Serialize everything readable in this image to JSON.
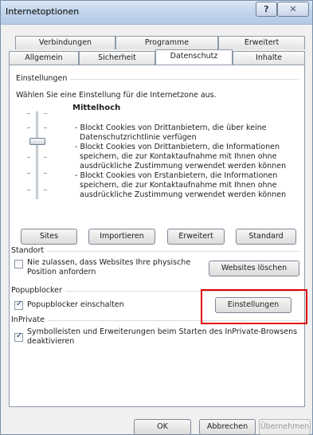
{
  "window": {
    "title": "Internetoptionen",
    "help_label": "?",
    "close_label": "✕"
  },
  "tabs_back": [
    "Verbindungen",
    "Programme",
    "Erweitert"
  ],
  "tabs_front": [
    "Allgemein",
    "Sicherheit",
    "Datenschutz",
    "Inhalte"
  ],
  "settings": {
    "group_label": "Einstellungen",
    "instruction": "Wählen Sie eine Einstellung für die Internetzone aus.",
    "level_title": "Mittelhoch",
    "lines": [
      "- Blockt Cookies von Drittanbietern, die über keine",
      "Datenschutzrichtlinie verfügen",
      "- Blockt Cookies von Drittanbietern, die Informationen",
      "speichern, die zur Kontaktaufnahme mit Ihnen ohne",
      "ausdrückliche Zustimmung verwendet werden können",
      "- Blockt Cookies von Erstanbietern, die Informationen",
      "speichern, die zur Kontaktaufnahme mit Ihnen ohne",
      "ausdrückliche Zustimmung verwendet werden können"
    ],
    "buttons": [
      "Sites",
      "Importieren",
      "Erweitert",
      "Standard"
    ]
  },
  "location": {
    "group_label": "Standort",
    "checkbox_line1": "Nie zulassen, dass Websites Ihre physische",
    "checkbox_line2": "Position anfordern",
    "delete_button": "Websites löschen"
  },
  "popup": {
    "group_label": "Popupblocker",
    "checkbox_label": "Popupblocker einschalten",
    "settings_button": "Einstellungen"
  },
  "inprivate": {
    "group_label": "InPrivate",
    "checkbox_line1": "Symbolleisten und Erweiterungen beim Starten des InPrivate-Browsens",
    "checkbox_line2": "deaktivieren"
  },
  "footer": {
    "ok": "OK",
    "cancel": "Abbrechen",
    "apply": "Übernehmen"
  }
}
